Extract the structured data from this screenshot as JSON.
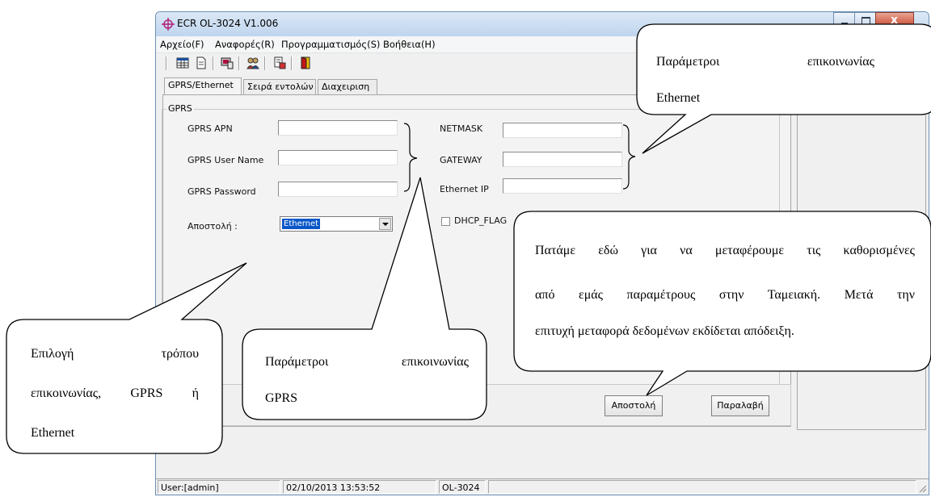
{
  "window": {
    "title": "ECR OL-3024 V1.006"
  },
  "menu": [
    "Αρχείο(F)",
    "Αναφορές(R)",
    "Προγραμματισμός(S)",
    "Βοήθεια(H)"
  ],
  "toolbar_icons": [
    "grid-icon",
    "document-icon",
    "monitor-icon",
    "users-icon",
    "report-icon",
    "exit-door-icon"
  ],
  "tabs": [
    "GPRS/Ethernet",
    "Σειρά εντολών",
    "Διαχειριση"
  ],
  "group_label": "GPRS",
  "fields": {
    "gprs_apn": "GPRS APN",
    "gprs_user": "GPRS User Name",
    "gprs_password": "GPRS Password",
    "netmask": "NETMASK",
    "gateway": "GATEWAY",
    "ethernet_ip": "Ethernet IP",
    "send_mode": "Αποστολή :"
  },
  "send_mode_value": "Ethernet",
  "dhcp_label": "DHCP_FLAG",
  "buttons": {
    "send": "Αποστολή",
    "receive": "Παραλαβή"
  },
  "status": {
    "user": "User:[admin]",
    "datetime": "02/10/2013 13:53:52",
    "model": "OL-3024"
  },
  "callouts": {
    "ethernet": [
      "Παράμετροι επικοινωνίας",
      "Ethernet"
    ],
    "send_button": [
      "Πατάμε εδώ για να μεταφέρουμε τις καθορισμένες",
      "από εμάς παραμέτρους στην Ταμειακή. Μετά την",
      "επιτυχή μεταφορά δεδομένων εκδίδεται απόδειξη."
    ],
    "mode": [
      "Επιλογή τρόπου",
      "επικοινωνίας, GPRS ή",
      "Ethernet"
    ],
    "gprs": [
      "Παράμετροι επικοινωνίας",
      "GPRS"
    ]
  }
}
